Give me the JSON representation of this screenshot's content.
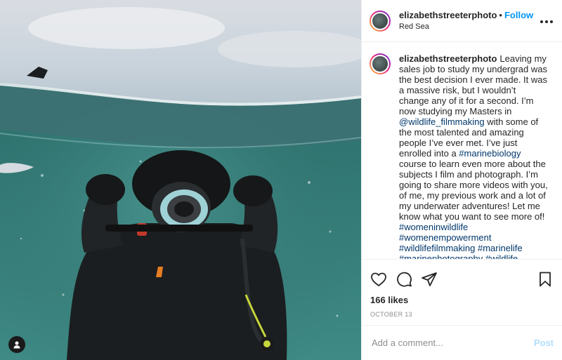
{
  "header": {
    "username": "elizabethstreeterphoto",
    "separator": "•",
    "follow_label": "Follow",
    "location": "Red Sea",
    "more_icon": "more-horizontal-icon"
  },
  "caption": {
    "username": "elizabethstreeterphoto",
    "text_1": "Leaving my sales job to study my undergrad was the best decision I ever made. It was a massive risk, but I wouldn’t change any of it for a second. I’m now studying my Masters in ",
    "mention": "@wildlife_filmmaking",
    "text_2": " with some of the most talented and amazing people I’ve ever met. I’ve just enrolled into a ",
    "hashtag_inline": "#marinebiology",
    "text_3": " course to learn even more about the subjects I film and photograph. I’m going to share more videos with you, of me, my previous work and a lot of my underwater adventures! Let me know what you want to see more of!",
    "hashtags": [
      "#womeninwildlife",
      "#womenempowerment",
      "#wildlifefilmmaking",
      "#marinelife",
      "#marinephotography",
      "#wildlife"
    ]
  },
  "actions": {
    "likes": "166 likes",
    "date": "OCTOBER 13",
    "icons": [
      "heart-icon",
      "comment-icon",
      "share-icon",
      "bookmark-icon"
    ]
  },
  "comment": {
    "placeholder": "Add a comment...",
    "post_label": "Post"
  },
  "colors": {
    "accent": "#0095f6",
    "link": "#00376b",
    "post_disabled": "#b2dffc",
    "water": "#2e6f6e"
  }
}
